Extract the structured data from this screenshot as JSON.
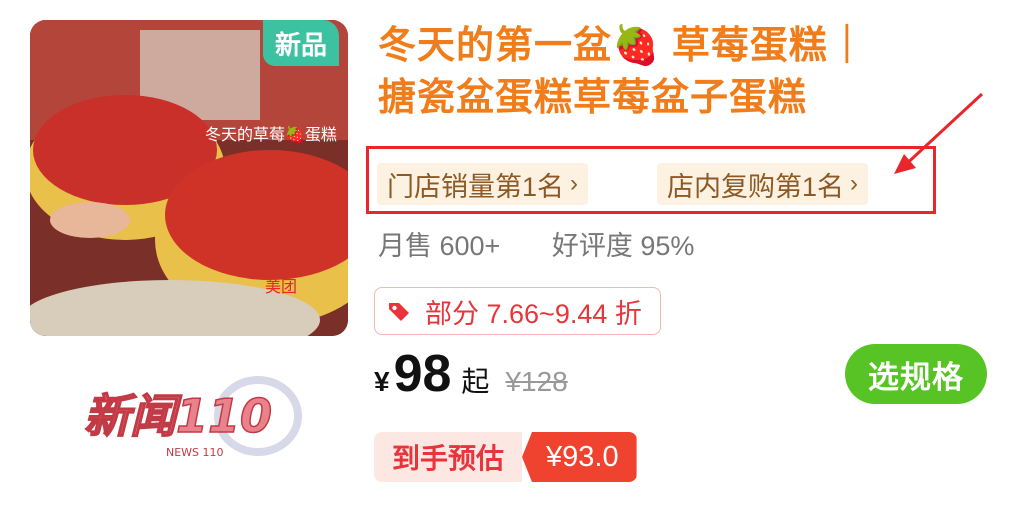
{
  "product": {
    "badge": "新品",
    "title_line1": "冬天的第一盆🍓 草莓蛋糕｜",
    "title_line2": "搪瓷盆蛋糕草莓盆子蛋糕",
    "thumb_caption": "冬天的草莓🍓蛋糕",
    "thumb_watermark": "美团"
  },
  "ranks": [
    {
      "label": "门店销量第1名",
      "chevron": "›"
    },
    {
      "label": "店内复购第1名",
      "chevron": "›"
    }
  ],
  "stats": {
    "monthly_sales": "月售 600+",
    "rating": "好评度 95%"
  },
  "discount": {
    "icon": "tag-icon",
    "text": "部分 7.66~9.44 折"
  },
  "price": {
    "currency": "¥",
    "value": "98",
    "suffix": "起",
    "original": "¥128"
  },
  "actions": {
    "spec_label": "选规格"
  },
  "estimate": {
    "label": "到手预估",
    "value": "¥93.0"
  },
  "watermark_logo": {
    "text": "新闻110",
    "sub": "NEWS 110"
  },
  "colors": {
    "title": "#f07d1a",
    "badge": "#3cc2a1",
    "highlight_box": "#e8262b",
    "spec_button": "#58c324",
    "estimate_value_bg": "#f0432f"
  }
}
